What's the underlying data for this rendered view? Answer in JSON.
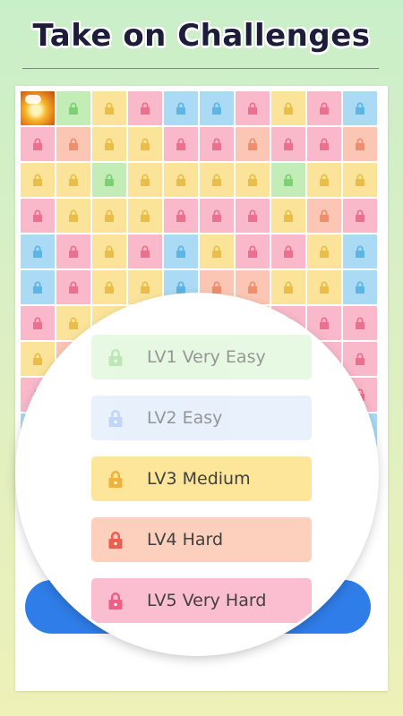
{
  "headline": "Take on Challenges",
  "grid": {
    "rows": [
      [
        "thumb",
        "green",
        "yellow",
        "pink",
        "blue",
        "blue",
        "pink",
        "yellow",
        "pink",
        "blue"
      ],
      [
        "pink",
        "peach",
        "yellow",
        "yellow",
        "pink",
        "pink",
        "peach",
        "pink",
        "pink",
        "peach"
      ],
      [
        "yellow",
        "yellow",
        "green",
        "yellow",
        "yellow",
        "yellow",
        "yellow",
        "green",
        "yellow",
        "yellow"
      ],
      [
        "pink",
        "yellow",
        "yellow",
        "yellow",
        "pink",
        "pink",
        "pink",
        "yellow",
        "peach",
        "pink"
      ],
      [
        "blue",
        "pink",
        "yellow",
        "pink",
        "blue",
        "yellow",
        "pink",
        "pink",
        "yellow",
        "blue"
      ],
      [
        "blue",
        "pink",
        "yellow",
        "yellow",
        "blue",
        "peach",
        "peach",
        "yellow",
        "yellow",
        "blue"
      ],
      [
        "pink",
        "yellow",
        "yellow",
        "pink",
        "pink",
        "pink",
        "yellow",
        "pink",
        "pink",
        "pink"
      ],
      [
        "yellow",
        "peach",
        "yellow",
        "yellow",
        "yellow",
        "pink",
        "pink",
        "yellow",
        "pink",
        "pink"
      ],
      [
        "pink",
        "pink",
        "peach",
        "pink",
        "pink",
        "peach",
        "pink",
        "pink",
        "peach",
        "pink"
      ],
      [
        "blue",
        "blue",
        "blue",
        "blue",
        "blue",
        "blue",
        "blue",
        "blue",
        "blue",
        "blue"
      ]
    ],
    "colors": {
      "pink": "#f9b9cb",
      "yellow": "#fbe49a",
      "peach": "#fbc7b4",
      "blue": "#aadaf4",
      "green": "#c3edb7"
    }
  },
  "levels": [
    {
      "id": "lv1",
      "label": "LV1 Very Easy",
      "lock_color": "#86d67c"
    },
    {
      "id": "lv2",
      "label": "LV2 Easy",
      "lock_color": "#8fb6f0"
    },
    {
      "id": "lv3",
      "label": "LV3 Medium",
      "lock_color": "#f0b23a"
    },
    {
      "id": "lv4",
      "label": "LV4 Hard",
      "lock_color": "#ee5c4f"
    },
    {
      "id": "lv5",
      "label": "LV5 Very Hard",
      "lock_color": "#ee5f86"
    }
  ],
  "accent_color": "#2f7de8"
}
